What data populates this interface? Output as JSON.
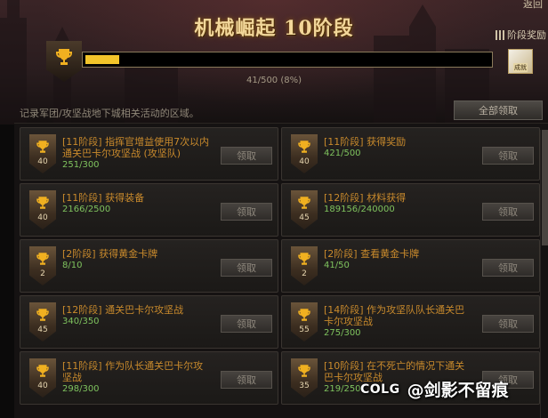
{
  "header": {
    "back_label": "返回",
    "title": "机械崛起 10阶段",
    "stage_reward_label": "阶段奖励",
    "progress_text": "41/500 (8%)",
    "progress_fraction": 0.08,
    "reward_tag": "成就"
  },
  "description": "记录军团/攻坚战地下城相关活动的区域。",
  "claim_all_label": "全部领取",
  "cards": [
    {
      "points": "40",
      "title": "[11阶段] 指挥官增益使用7次以内通关巴卡尔攻坚战 (攻坚队)",
      "progress": "251/300",
      "button": "领取"
    },
    {
      "points": "40",
      "title": "[11阶段] 获得奖励",
      "progress": "421/500",
      "button": "领取"
    },
    {
      "points": "40",
      "title": "[11阶段] 获得装备",
      "progress": "2166/2500",
      "button": "领取"
    },
    {
      "points": "45",
      "title": "[12阶段] 材料获得",
      "progress": "189156/240000",
      "button": "领取"
    },
    {
      "points": "2",
      "title": "[2阶段] 获得黄金卡牌",
      "progress": "8/10",
      "button": "领取"
    },
    {
      "points": "2",
      "title": "[2阶段] 查看黄金卡牌",
      "progress": "41/50",
      "button": "领取"
    },
    {
      "points": "45",
      "title": "[12阶段] 通关巴卡尔攻坚战",
      "progress": "340/350",
      "button": "领取"
    },
    {
      "points": "55",
      "title": "[14阶段] 作为攻坚队队长通关巴卡尔攻坚战",
      "progress": "275/300",
      "button": "领取"
    },
    {
      "points": "40",
      "title": "[11阶段] 作为队长通关巴卡尔攻坚战",
      "progress": "298/300",
      "button": "领取"
    },
    {
      "points": "35",
      "title": "[10阶段] 在不死亡的情况下通关巴卡尔攻坚战",
      "progress": "219/250",
      "button": "领取"
    }
  ],
  "watermark": {
    "brand": "COLG",
    "handle": "@剑影不留痕"
  },
  "colors": {
    "accent_gold": "#f3c52a",
    "title_orange": "#c98a2c",
    "progress_green": "#7fc35e"
  },
  "icons": {
    "trophy": "trophy-icon",
    "stage_reward": "bars-icon"
  }
}
